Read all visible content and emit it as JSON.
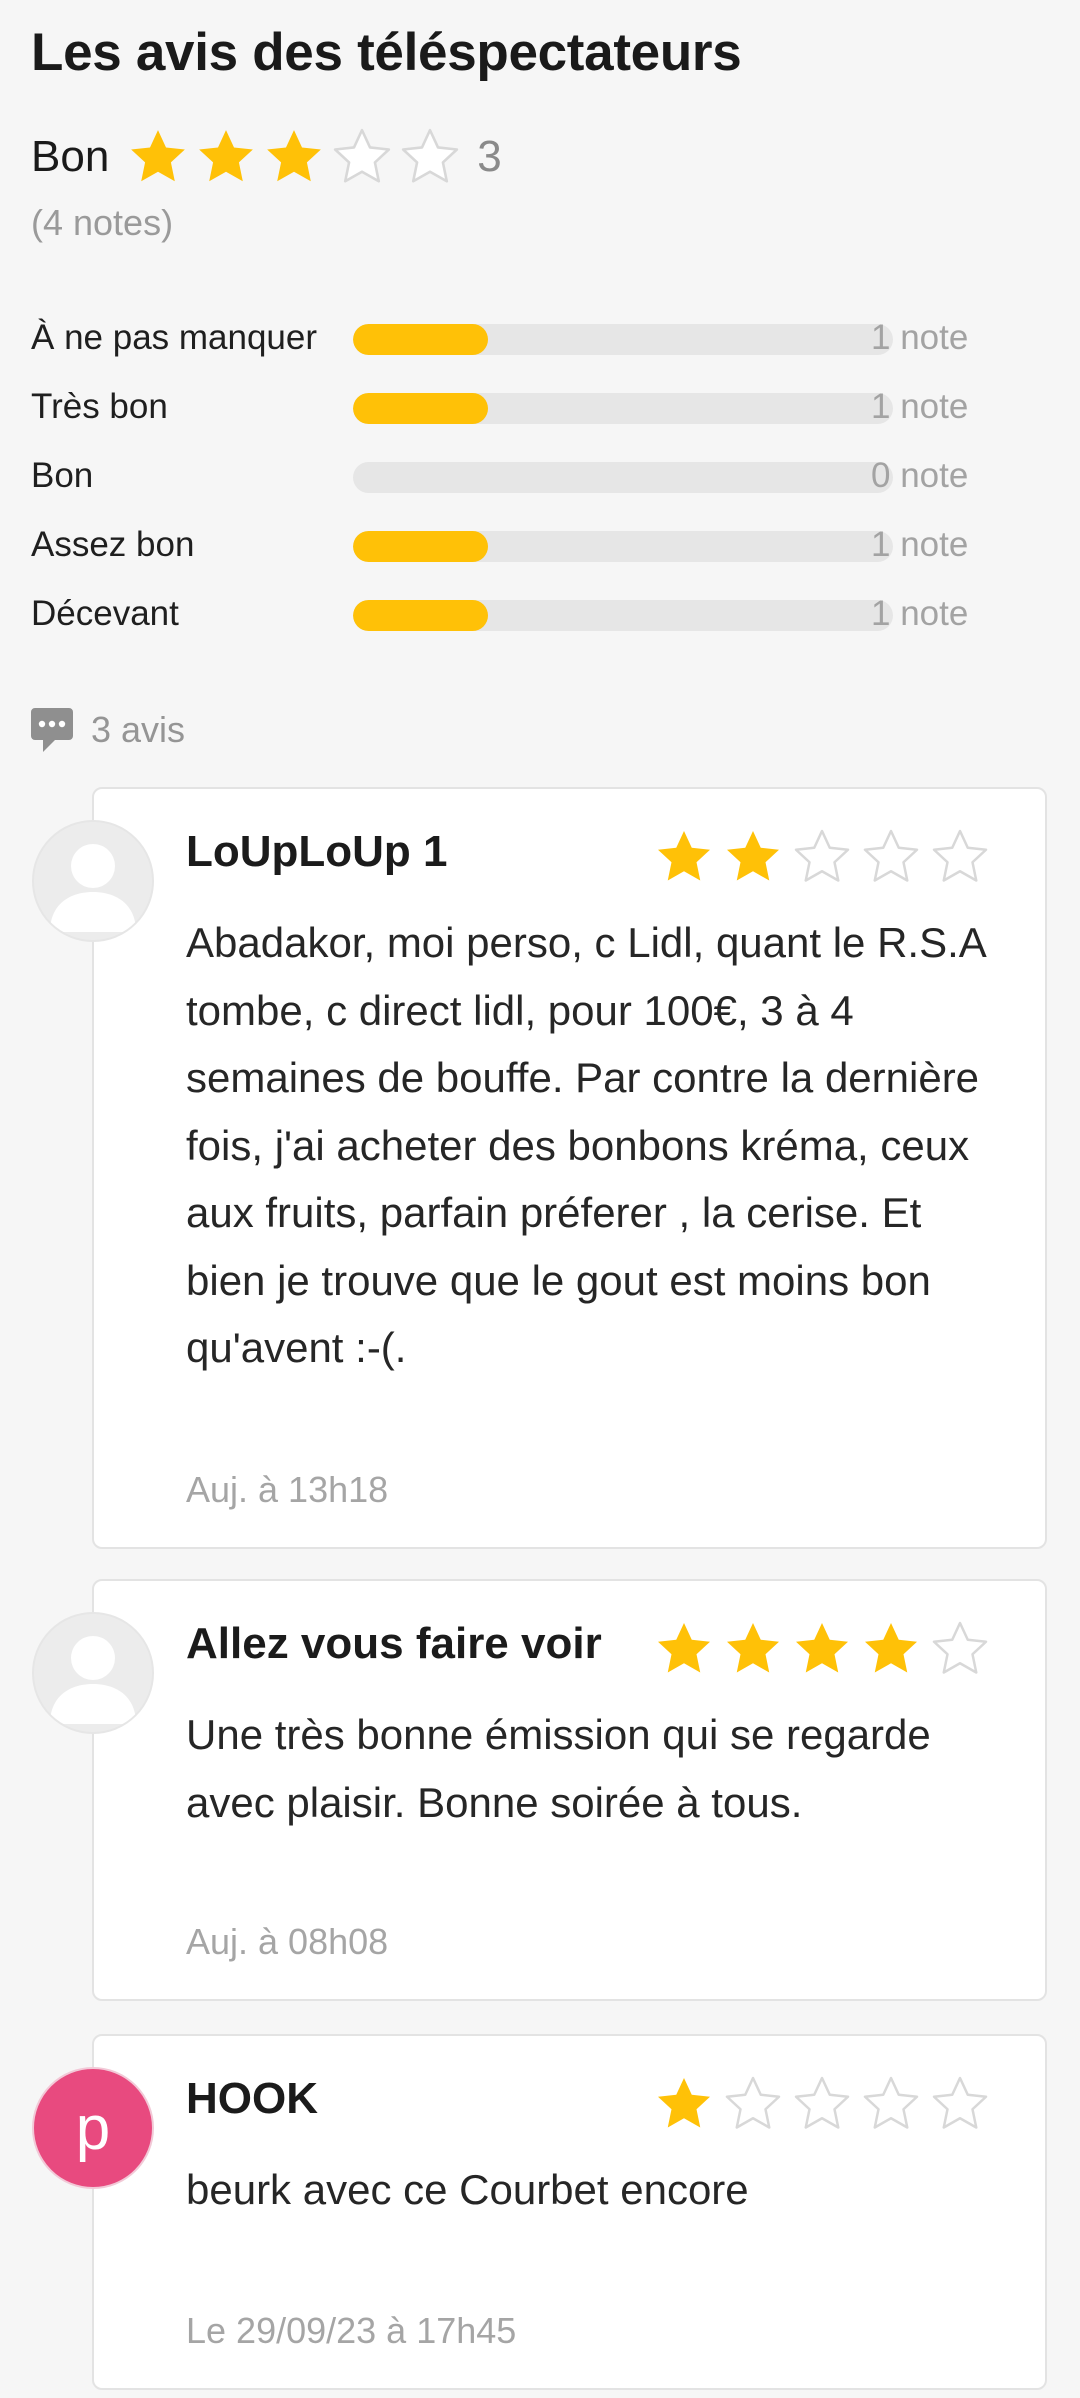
{
  "section_title": "Les avis des téléspectateurs",
  "summary": {
    "label": "Bon",
    "rating": 3,
    "max_rating": 5,
    "score_text": "3",
    "count_text": "(4 notes)"
  },
  "distribution": [
    {
      "label": "À ne pas manquer",
      "count_text": "1 note",
      "fraction": 0.25
    },
    {
      "label": "Très bon",
      "count_text": "1 note",
      "fraction": 0.25
    },
    {
      "label": "Bon",
      "count_text": "0 note",
      "fraction": 0
    },
    {
      "label": "Assez bon",
      "count_text": "1 note",
      "fraction": 0.25
    },
    {
      "label": "Décevant",
      "count_text": "1 note",
      "fraction": 0.25
    }
  ],
  "reviews_count_text": "3 avis",
  "reviews": [
    {
      "author": "LoUpLoUp 1",
      "rating": 2,
      "text": "Abadakor, moi perso, c Lidl, quant le R.S.A tombe, c direct lidl, pour 100€, 3 à 4 semaines de bouffe. Par contre la dernière fois, j'ai acheter des bonbons kréma, ceux aux fruits, parfain préferer , la cerise. Et bien je trouve que le gout est moins bon qu'avent :-(.",
      "date": "Auj. à 13h18",
      "avatar": "placeholder"
    },
    {
      "author": "Allez vous faire voir",
      "rating": 4,
      "text": "Une très bonne émission qui se regarde avec plaisir. Bonne soirée à tous.",
      "date": "Auj. à 08h08",
      "avatar": "placeholder"
    },
    {
      "author": "HOOK",
      "rating": 1,
      "text": "beurk avec ce Courbet encore",
      "date": "Le 29/09/23 à 17h45",
      "avatar": "letter",
      "avatar_letter": "p"
    }
  ],
  "colors": {
    "star_filled": "#ffc107",
    "star_empty_stroke": "#d8d8d8",
    "bar_fill": "#ffc107",
    "bar_track": "#e6e6e6",
    "avatar_letter_bg": "#e84a7f"
  },
  "icons": {
    "star": "star-icon",
    "comments": "comment-bubble-icon",
    "avatar_placeholder": "user-placeholder-icon"
  }
}
